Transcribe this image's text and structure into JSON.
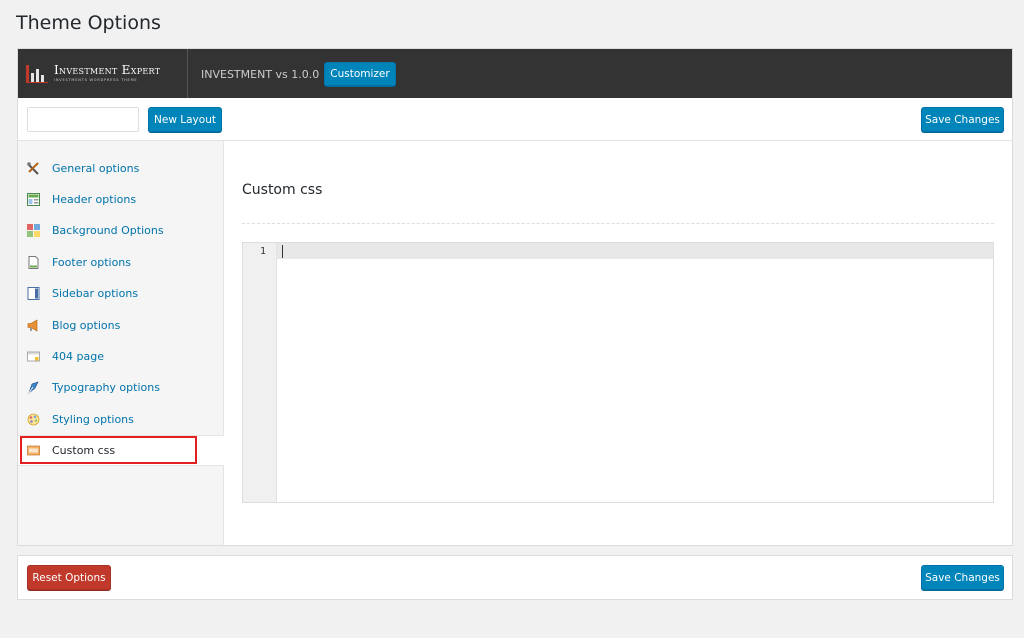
{
  "page": {
    "title": "Theme Options"
  },
  "header": {
    "logo_title": "Investment Expert",
    "logo_subtitle": "INVESTMENTS WORDPRESS THEME",
    "version": "INVESTMENT vs 1.0.0",
    "customizer_label": "Customizer"
  },
  "toolbar": {
    "layout_input_value": "",
    "new_layout_label": "New Layout",
    "save_label": "Save Changes"
  },
  "sidebar": {
    "items": [
      {
        "label": "General options",
        "icon": "tools-icon"
      },
      {
        "label": "Header options",
        "icon": "header-layout-icon"
      },
      {
        "label": "Background Options",
        "icon": "color-squares-icon"
      },
      {
        "label": "Footer options",
        "icon": "document-icon"
      },
      {
        "label": "Sidebar options",
        "icon": "sidebar-layout-icon"
      },
      {
        "label": "Blog options",
        "icon": "megaphone-icon"
      },
      {
        "label": "404 page",
        "icon": "page-warning-icon"
      },
      {
        "label": "Typography options",
        "icon": "pen-nib-icon"
      },
      {
        "label": "Styling options",
        "icon": "palette-icon"
      },
      {
        "label": "Custom css",
        "icon": "css-file-icon",
        "active": true
      }
    ]
  },
  "content": {
    "section_title": "Custom css",
    "editor": {
      "line_number": "1",
      "code": ""
    }
  },
  "footer": {
    "reset_label": "Reset Options",
    "save_label": "Save Changes"
  },
  "colors": {
    "accent": "#0085ba",
    "danger": "#c0392b",
    "highlight": "#e31f1f",
    "topbar": "#333333"
  }
}
